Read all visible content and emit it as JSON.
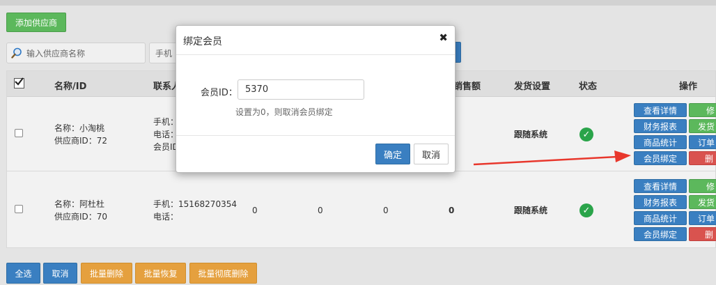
{
  "toolbar": {
    "add_supplier_label": "添加供应商"
  },
  "search": {
    "supplier_placeholder": "输入供应商名称",
    "phone_placeholder": "手机"
  },
  "table": {
    "headers": {
      "name_id": "名称/ID",
      "contact": "联系人",
      "sales_amount": "销售额",
      "shipping": "发货设置",
      "status": "状态",
      "actions": "操作"
    },
    "rows": [
      {
        "name": "名称：小淘桃",
        "supplier_id": "供应商ID：72",
        "phone": "手机：",
        "tel": "电话：",
        "member_id": "会员ID",
        "shipping": "跟随系统"
      },
      {
        "name": "名称：阿杜杜",
        "supplier_id": "供应商ID：70",
        "phone": "手机：15168270354",
        "tel": "电话：",
        "col3": "0",
        "col4": "0",
        "col5": "0",
        "sales": "0",
        "shipping": "跟随系统"
      }
    ],
    "actions": {
      "view_details": "查看详情",
      "finance_report": "财务报表",
      "product_stats": "商品统计",
      "bind_member": "会员绑定",
      "edit": "修",
      "ship": "发货",
      "orders": "订单",
      "delete": "删"
    }
  },
  "bulk": {
    "select_all": "全选",
    "cancel": "取消",
    "bulk_delete": "批量删除",
    "bulk_restore": "批量恢复",
    "bulk_purge": "批量彻底删除"
  },
  "modal": {
    "title": "绑定会员",
    "close_glyph": "✖",
    "field_label": "会员ID：",
    "field_value": "5370",
    "hint": "设置为0，则取消会员绑定",
    "confirm": "确定",
    "cancel": "取消"
  },
  "colors": {
    "green": "#5cb85c",
    "blue": "#3a7fc1",
    "orange": "#e5a03e",
    "red": "#d9534f",
    "status_ok": "#2aa44a",
    "arrow": "#e8372c"
  }
}
